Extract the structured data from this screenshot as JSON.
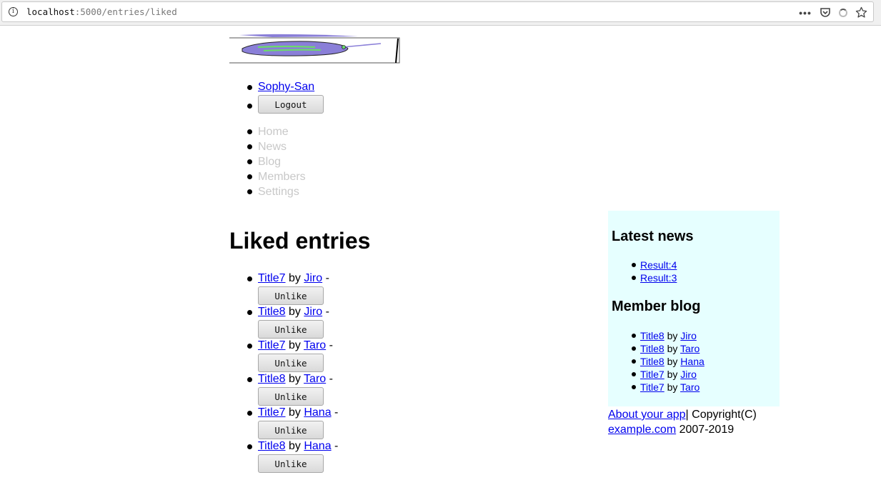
{
  "browser": {
    "url_host": "localhost",
    "url_path": ":5000/entries/liked"
  },
  "user_menu": {
    "username": "Sophy-San",
    "logout_label": "Logout"
  },
  "nav": [
    "Home",
    "News",
    "Blog",
    "Members",
    "Settings"
  ],
  "page_title": "Liked entries",
  "entries": [
    {
      "title": "Title7",
      "by": "by",
      "author": "Jiro",
      "dash": "-",
      "button": "Unlike"
    },
    {
      "title": "Title8",
      "by": "by",
      "author": "Jiro",
      "dash": "-",
      "button": "Unlike"
    },
    {
      "title": "Title7",
      "by": "by",
      "author": "Taro",
      "dash": "-",
      "button": "Unlike"
    },
    {
      "title": "Title8",
      "by": "by",
      "author": "Taro",
      "dash": "-",
      "button": "Unlike"
    },
    {
      "title": "Title7",
      "by": "by",
      "author": "Hana",
      "dash": "-",
      "button": "Unlike"
    },
    {
      "title": "Title8",
      "by": "by",
      "author": "Hana",
      "dash": "-",
      "button": "Unlike"
    }
  ],
  "sidebar": {
    "news_heading": "Latest news",
    "news": [
      "Result:4",
      "Result:3"
    ],
    "blog_heading": "Member blog",
    "blog": [
      {
        "title": "Title8",
        "by": "by",
        "author": "Jiro"
      },
      {
        "title": "Title8",
        "by": "by",
        "author": "Taro"
      },
      {
        "title": "Title8",
        "by": "by",
        "author": "Hana"
      },
      {
        "title": "Title7",
        "by": "by",
        "author": "Jiro"
      },
      {
        "title": "Title7",
        "by": "by",
        "author": "Taro"
      }
    ],
    "background": "#e6ffff"
  },
  "footer": {
    "about_link": "About your app",
    "copyright_text": "| Copyright(C)",
    "site_link": "example.com",
    "years": "2007-2019"
  },
  "icons": [
    "info-icon",
    "more-icon",
    "pocket-icon",
    "loading-icon",
    "bookmark-star-icon"
  ]
}
